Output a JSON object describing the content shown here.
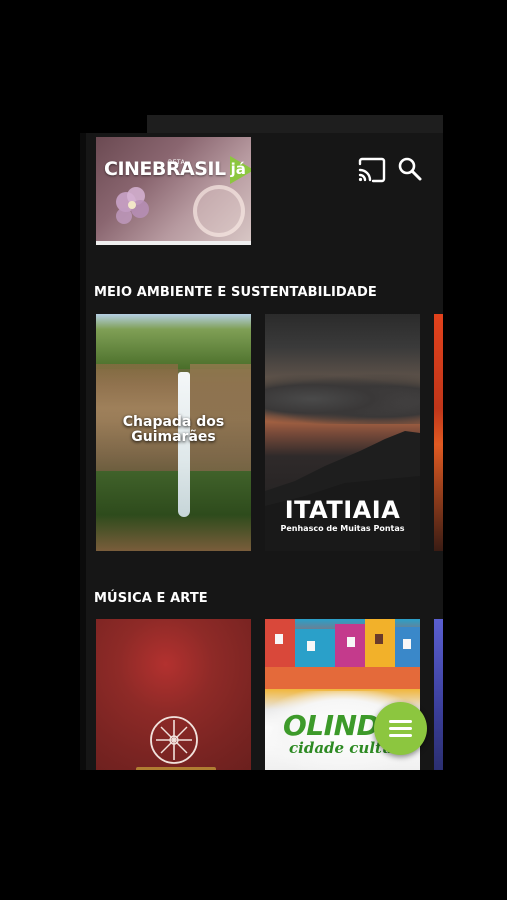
{
  "app": {
    "logo_text": "CINEBRASIL",
    "logo_ja": "já",
    "logo_beta": "BETA",
    "brand_color": "#8cc63f"
  },
  "header": {
    "cast_icon": "cast-icon",
    "search_icon": "search-icon"
  },
  "sections": [
    {
      "title": "MEIO AMBIENTE E SUSTENTABILIDADE",
      "items": [
        {
          "title_line1": "Chapada dos",
          "title_line2": "Guimarães"
        },
        {
          "title": "ITATIAIA",
          "subtitle": "Penhasco de Muitas Pontas"
        }
      ]
    },
    {
      "title": "MÚSICA E ARTE",
      "items": [
        {
          "title": ""
        },
        {
          "title": "OLIND",
          "subtitle": "cidade cultur"
        }
      ]
    }
  ],
  "fab": {
    "icon": "menu-icon",
    "color": "#8cc63f"
  }
}
